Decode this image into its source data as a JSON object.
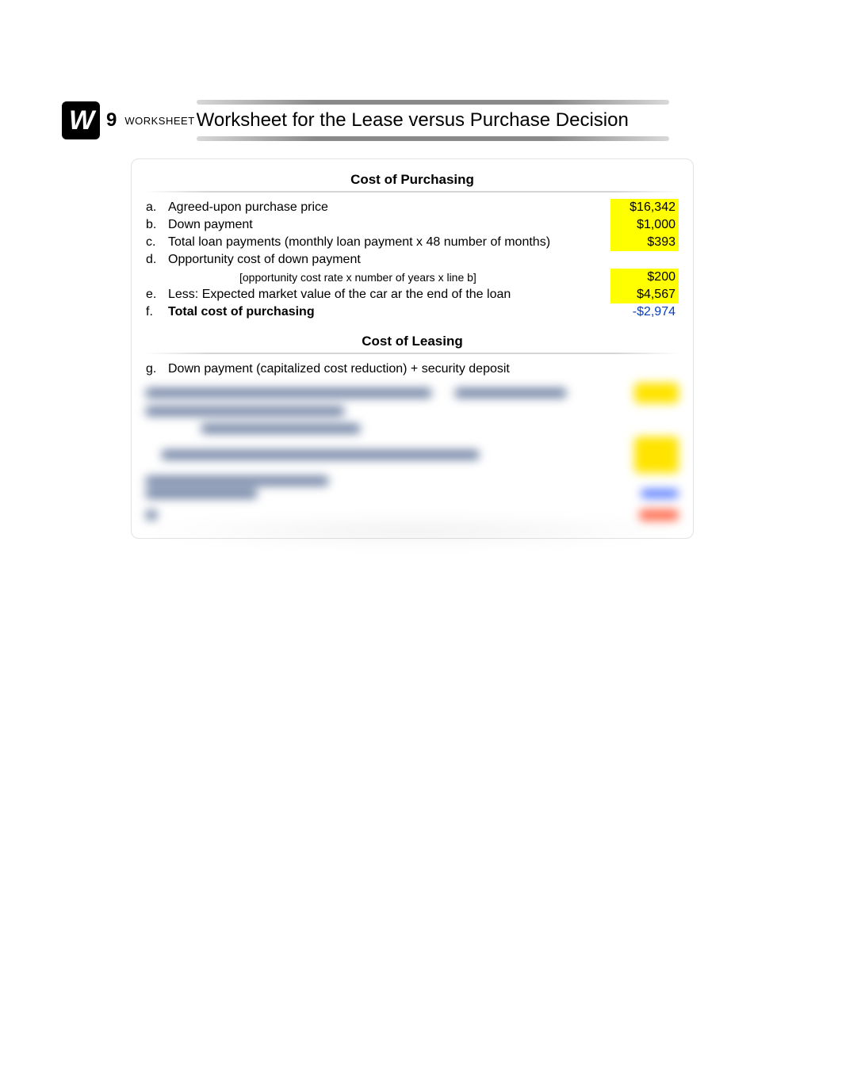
{
  "header": {
    "badge_letter": "W",
    "number": "9",
    "small_label": "WORKSHEET",
    "title": "Worksheet for the Lease versus Purchase Decision"
  },
  "sections": {
    "purchasing_title": "Cost of Purchasing",
    "leasing_title": "Cost of Leasing"
  },
  "purchasing": {
    "a": {
      "marker": "a.",
      "label": "Agreed-upon purchase price",
      "value": "$16,342"
    },
    "b": {
      "marker": "b.",
      "label": "Down payment",
      "value": "$1,000"
    },
    "c": {
      "marker": "c.",
      "label": "Total loan payments (monthly loan payment  x 48 number of months)",
      "value": "$393"
    },
    "d": {
      "marker": "d.",
      "label": "Opportunity cost of down payment"
    },
    "d_formula": "[opportunity cost rate x number of years x line b]",
    "d_value": "$200",
    "e": {
      "marker": "e.",
      "label": "Less: Expected market value of the car ar the end of the loan",
      "value": "$4,567"
    },
    "f": {
      "marker": "f.",
      "label": "Total cost of purchasing",
      "value": "-$2,974"
    }
  },
  "leasing": {
    "g": {
      "marker": "g.",
      "label": "Down payment (capitalized cost reduction) + security deposit"
    }
  }
}
